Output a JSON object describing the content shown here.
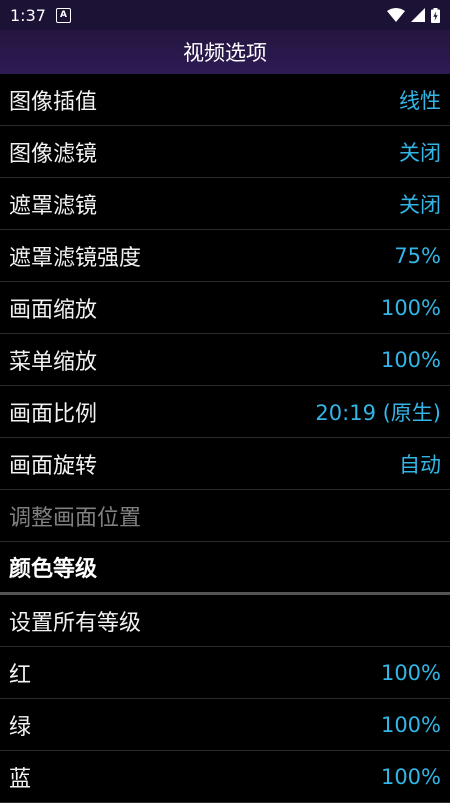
{
  "status": {
    "time": "1:37",
    "notification_badge": "A",
    "icons": [
      "wifi-icon",
      "signal-icon",
      "battery-charging-icon"
    ]
  },
  "header": {
    "title": "视频选项"
  },
  "items": [
    {
      "label": "图像插值",
      "value": "线性"
    },
    {
      "label": "图像滤镜",
      "value": "关闭"
    },
    {
      "label": "遮罩滤镜",
      "value": "关闭"
    },
    {
      "label": "遮罩滤镜强度",
      "value": "75%"
    },
    {
      "label": "画面缩放",
      "value": "100%"
    },
    {
      "label": "菜单缩放",
      "value": "100%"
    },
    {
      "label": "画面比例",
      "value": "20:19 (原生)"
    },
    {
      "label": "画面旋转",
      "value": "自动"
    },
    {
      "label": "调整画面位置",
      "value": ""
    }
  ],
  "section": {
    "title": "颜色等级"
  },
  "color_items": [
    {
      "label": "设置所有等级",
      "value": ""
    },
    {
      "label": "红",
      "value": "100%"
    },
    {
      "label": "绿",
      "value": "100%"
    },
    {
      "label": "蓝",
      "value": "100%"
    }
  ],
  "colors": {
    "accent": "#33b5e5",
    "titlebar": "#2e1a55",
    "background": "#000000"
  }
}
